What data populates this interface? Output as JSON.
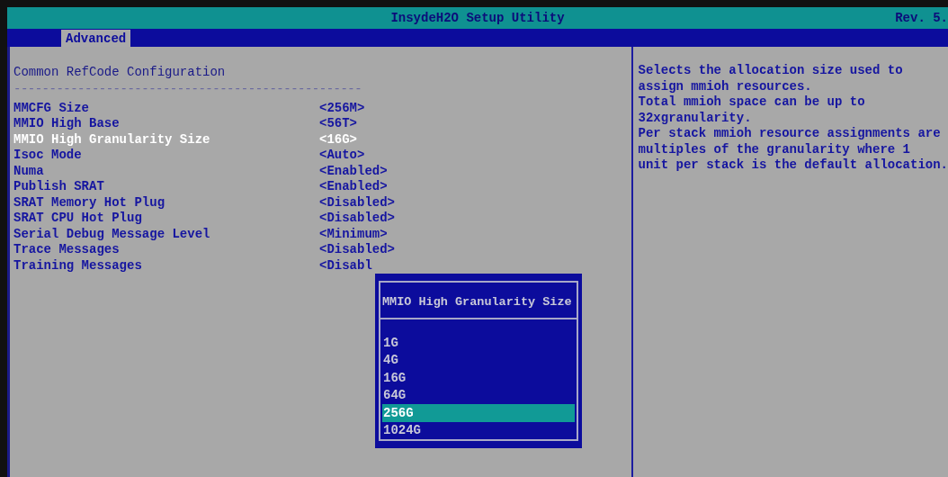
{
  "window": {
    "title": "InsydeH2O Setup Utility",
    "revision": "Rev. 5."
  },
  "tabs": [
    {
      "label": "Advanced",
      "selected": true
    }
  ],
  "section": {
    "title": "Common RefCode Configuration",
    "rule": "-------------------------------------------------"
  },
  "settings": [
    {
      "label": "MMCFG Size",
      "value": "<256M>",
      "selected": false
    },
    {
      "label": "MMIO High Base",
      "value": "<56T>",
      "selected": false
    },
    {
      "label": "MMIO High Granularity Size",
      "value": "<16G>",
      "selected": true
    },
    {
      "label": "Isoc Mode",
      "value": "<Auto>",
      "selected": false
    },
    {
      "label": "Numa",
      "value": "<Enabled>",
      "selected": false
    },
    {
      "label": "Publish SRAT",
      "value": "<Enabled>",
      "selected": false
    },
    {
      "label": "SRAT Memory Hot Plug",
      "value": "<Disabled>",
      "selected": false
    },
    {
      "label": "SRAT CPU Hot Plug",
      "value": "<Disabled>",
      "selected": false
    },
    {
      "label": "Serial Debug Message Level",
      "value": "<Minimum>",
      "selected": false
    },
    {
      "label": "Trace Messages",
      "value": "<Disabled>",
      "selected": false
    },
    {
      "label": "Training Messages",
      "value": "<Disabl",
      "selected": false
    }
  ],
  "help": [
    "Selects the allocation size used to",
    "assign mmioh resources.",
    "Total mmioh space can be up to",
    "32xgranularity.",
    "Per stack mmioh resource assignments are",
    "multiples of the granularity where 1",
    "unit per stack is the default allocation."
  ],
  "popup": {
    "title": "MMIO High Granularity Size",
    "options": [
      {
        "label": "1G",
        "selected": false
      },
      {
        "label": "4G",
        "selected": false
      },
      {
        "label": "16G",
        "selected": false
      },
      {
        "label": "64G",
        "selected": false
      },
      {
        "label": "256G",
        "selected": true
      },
      {
        "label": "1024G",
        "selected": false
      }
    ]
  }
}
